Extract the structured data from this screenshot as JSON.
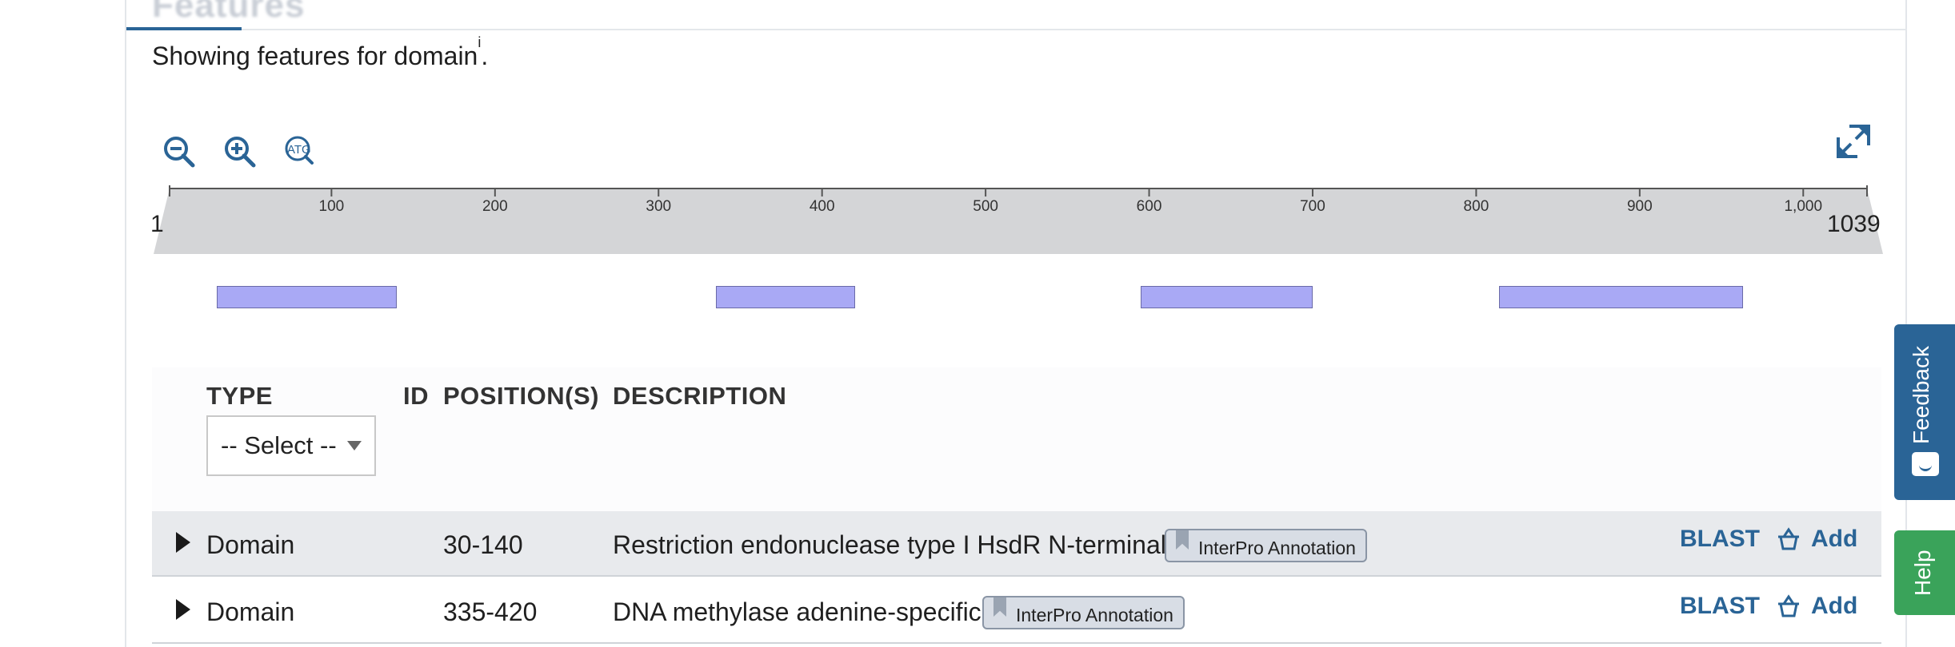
{
  "section": {
    "title": "Features"
  },
  "intro": {
    "text": "Showing features for domain",
    "superscript": "i",
    "suffix": "."
  },
  "toolbar": {
    "zoom_out_icon": "zoom-out-icon",
    "zoom_in_icon": "zoom-in-icon",
    "sequence_icon_label": "ATG",
    "fullscreen_icon": "expand-icon"
  },
  "ruler": {
    "start": "1",
    "end": "1039",
    "ticks": [
      "100",
      "200",
      "300",
      "400",
      "500",
      "600",
      "700",
      "800",
      "900",
      "1,000"
    ]
  },
  "track": {
    "length": 1039,
    "features": [
      {
        "start": 30,
        "end": 140
      },
      {
        "start": 335,
        "end": 420
      },
      {
        "start": 595,
        "end": 700
      },
      {
        "start": 814,
        "end": 963
      }
    ],
    "color": "#a9a9f5"
  },
  "table": {
    "headers": {
      "type": "TYPE",
      "id": "ID",
      "positions": "POSITION(S)",
      "description": "DESCRIPTION"
    },
    "filter": {
      "selected": "-- Select --"
    },
    "rows": [
      {
        "type": "Domain",
        "position": "30-140",
        "description": "Restriction endonuclease type I HsdR N-terminal",
        "badge": "InterPro Annotation",
        "blast": "BLAST",
        "add": "Add"
      },
      {
        "type": "Domain",
        "position": "335-420",
        "description": "DNA methylase adenine-specific",
        "badge": "InterPro Annotation",
        "blast": "BLAST",
        "add": "Add"
      }
    ]
  },
  "side_tabs": {
    "feedback": "Feedback",
    "help": "Help"
  },
  "colors": {
    "link": "#2a6496",
    "feedback": "#2a6496",
    "help": "#3aa35a",
    "row_shade": "#e8eaed"
  }
}
